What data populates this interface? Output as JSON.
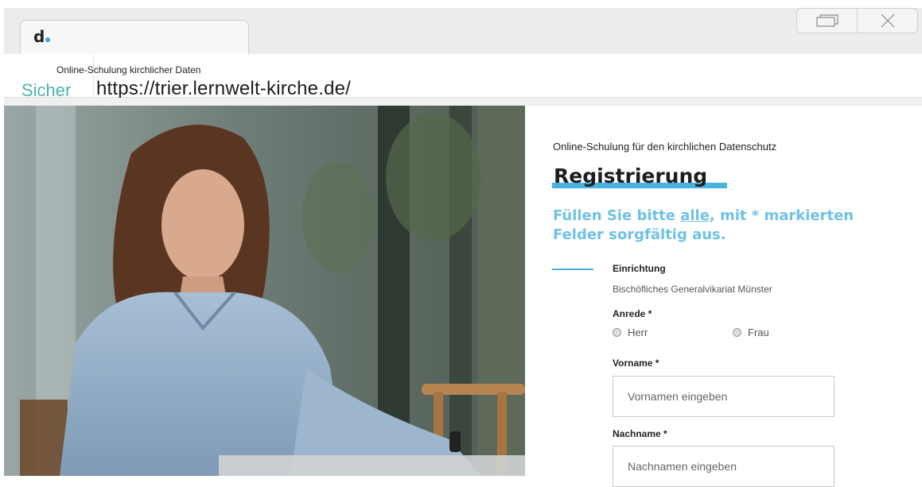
{
  "browser": {
    "logo_letter": "d",
    "tab_tooltip": "Online-Schulung kirchlicher Daten",
    "secure_label": "Sicher",
    "url": "https://trier.lernwelt-kirche.de/"
  },
  "form": {
    "subtitle": "Online-Schulung für den kirchlichen Datenschutz",
    "title": "Registrierung",
    "instruction_before": "Füllen Sie bitte ",
    "instruction_underlined": "alle",
    "instruction_after": ", mit * markierten Felder sorgfältig aus.",
    "einrichtung_label": "Einrichtung",
    "einrichtung_value": "Bischöfliches Generalvikariat Münster",
    "anrede_label": "Anrede *",
    "radio_herr": "Herr",
    "radio_frau": "Frau",
    "vorname_label": "Vorname *",
    "vorname_placeholder": "Vornamen eingeben",
    "nachname_label": "Nachname *",
    "nachname_placeholder": "Nachnamen eingeben"
  },
  "colors": {
    "accent": "#45b2e0",
    "accent_light": "#6ec2e6",
    "secure": "#4eb3a5"
  },
  "icons": [
    "restore-window-icon",
    "close-window-icon",
    "radio-circle-icon"
  ]
}
